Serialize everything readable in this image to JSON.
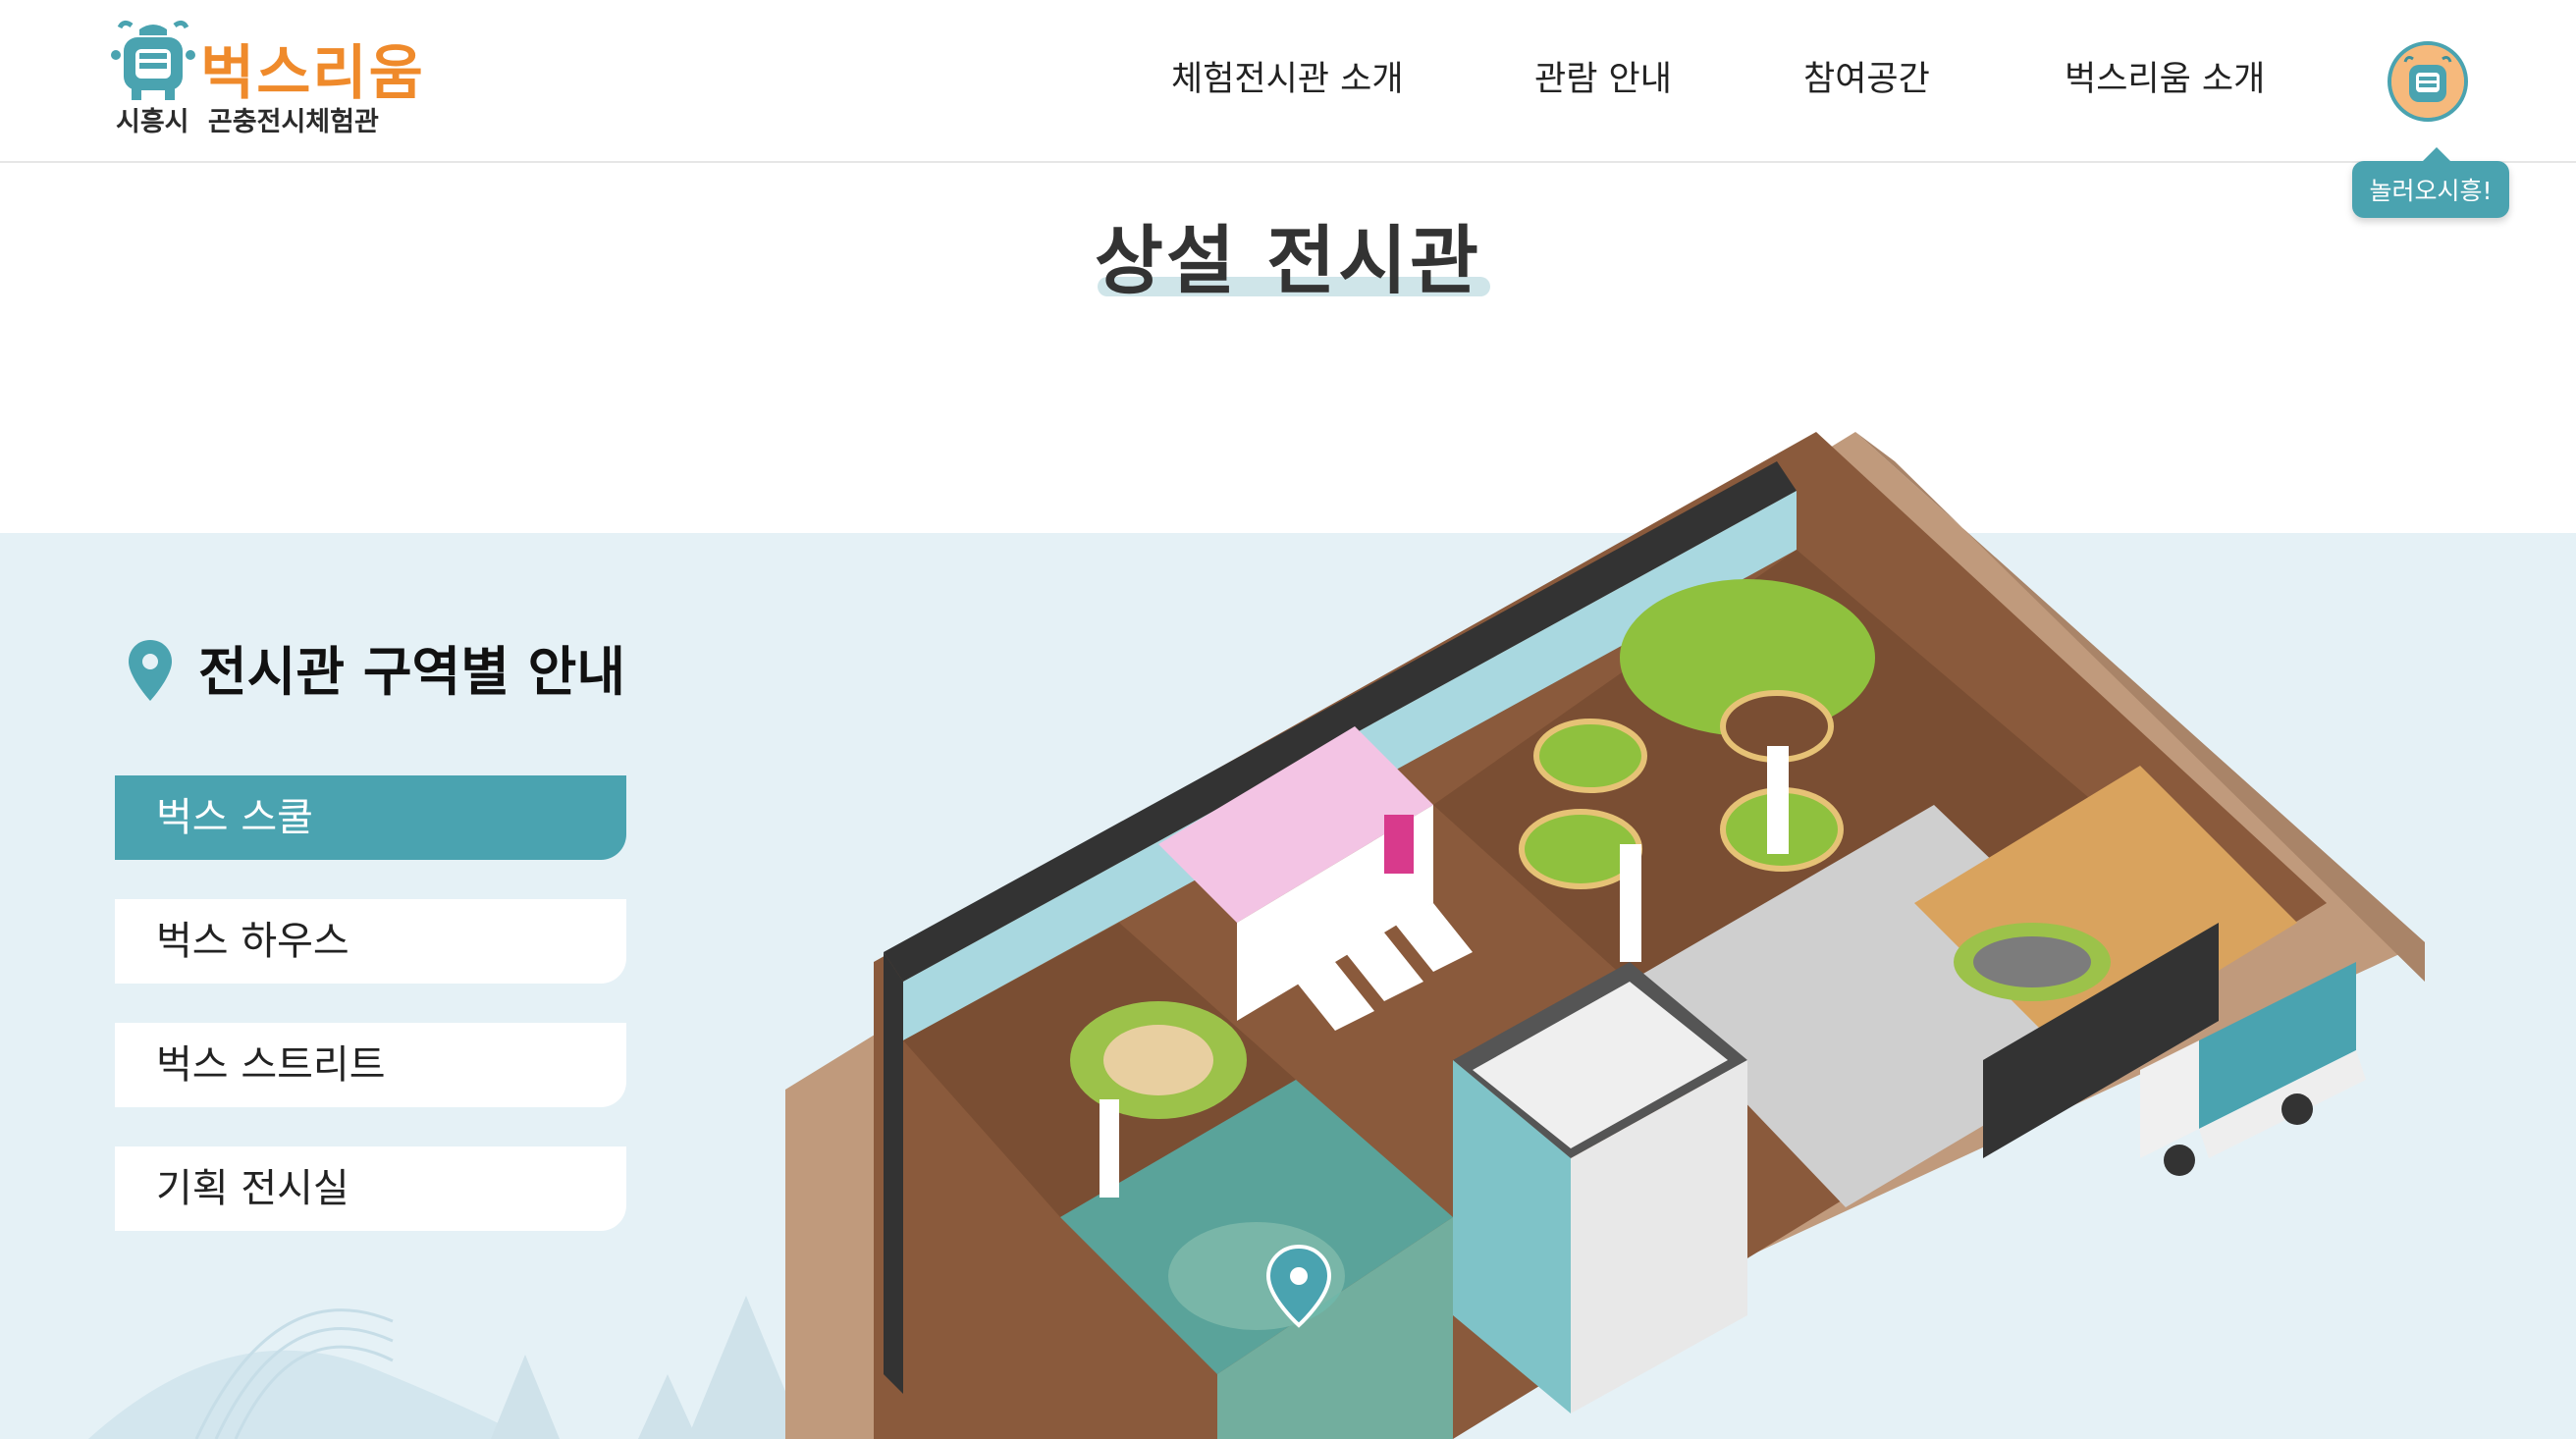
{
  "header": {
    "logo": {
      "title": "벅스리움",
      "subtitle": "시흥시 곤충전시체험관"
    },
    "nav": [
      {
        "label": "체험전시관 소개"
      },
      {
        "label": "관람 안내"
      },
      {
        "label": "참여공간"
      },
      {
        "label": "벅스리움 소개"
      }
    ],
    "tooltip": "놀러오시흥!"
  },
  "page": {
    "title": "상설 전시관"
  },
  "guide": {
    "heading": "전시관 구역별 안내",
    "zones": [
      {
        "label": "벅스 스쿨",
        "active": true
      },
      {
        "label": "벅스 하우스",
        "active": false
      },
      {
        "label": "벅스 스트리트",
        "active": false
      },
      {
        "label": "기획 전시실",
        "active": false
      }
    ]
  },
  "colors": {
    "accent": "#4aa3b0",
    "logo_orange": "#ef8a2b",
    "band_background": "#e5f1f6",
    "title_underline": "#cfe5e9"
  },
  "icons": [
    "mascot-logo-icon",
    "mascot-avatar-icon",
    "location-pin-icon",
    "map-pin-icon"
  ]
}
